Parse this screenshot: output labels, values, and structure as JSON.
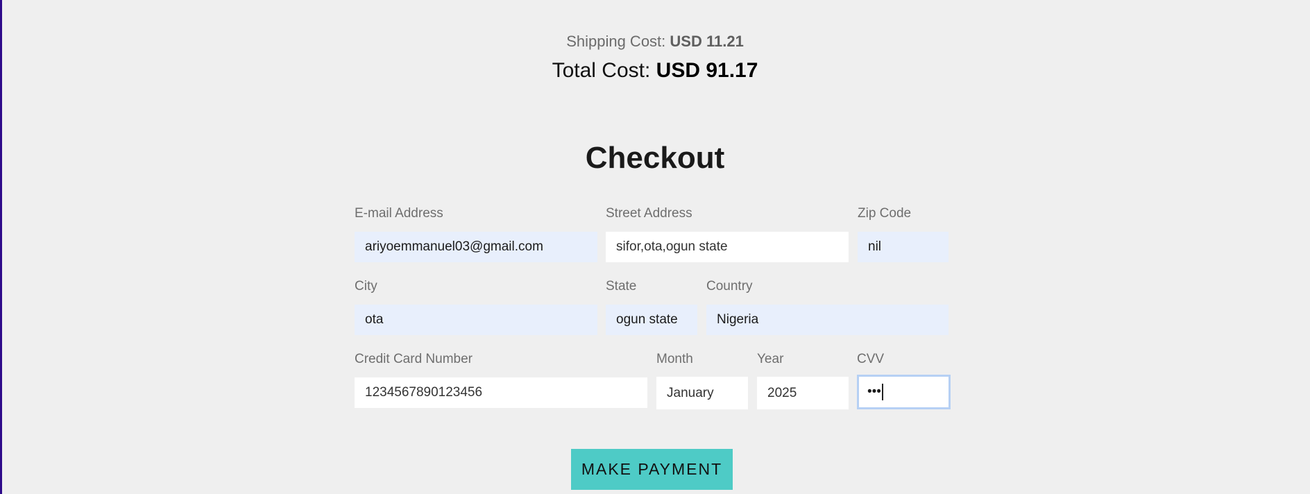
{
  "summary": {
    "shipping_label": "Shipping Cost:",
    "shipping_value": "USD 11.21",
    "total_label": "Total Cost:",
    "total_value": "USD 91.17"
  },
  "checkout": {
    "title": "Checkout",
    "fields": {
      "email": {
        "label": "E-mail Address",
        "value": "ariyoemmanuel03@gmail.com"
      },
      "street": {
        "label": "Street Address",
        "value": "sifor,ota,ogun state"
      },
      "zip": {
        "label": "Zip Code",
        "value": "nil"
      },
      "city": {
        "label": "City",
        "value": "ota"
      },
      "state": {
        "label": "State",
        "value": "ogun state"
      },
      "country": {
        "label": "Country",
        "value": "Nigeria"
      },
      "card": {
        "label": "Credit Card Number",
        "value": "1234567890123456"
      },
      "month": {
        "label": "Month",
        "value": "January"
      },
      "year": {
        "label": "Year",
        "value": "2025"
      },
      "cvv": {
        "label": "CVV",
        "value": "•••"
      }
    },
    "submit_label": "MAKE PAYMENT"
  },
  "colors": {
    "accent": "#4ecbc6",
    "autofill": "#e8effc",
    "focus_border": "#b6d0f4",
    "left_border": "#2e0b8a"
  }
}
